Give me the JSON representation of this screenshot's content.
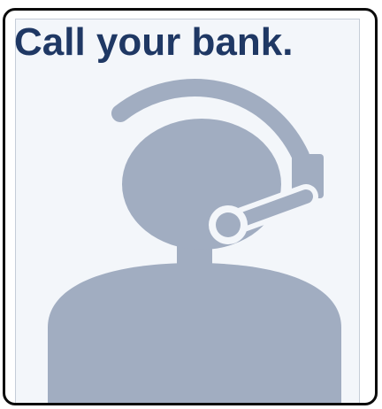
{
  "heading": {
    "text": "Call your bank."
  },
  "illustration": {
    "icon": "customer-support-headset-icon"
  },
  "colors": {
    "heading": "#1f3864",
    "icon": "#a1adc1",
    "card_border": "#0b0b0b",
    "card_background": "#f3f6fa"
  }
}
